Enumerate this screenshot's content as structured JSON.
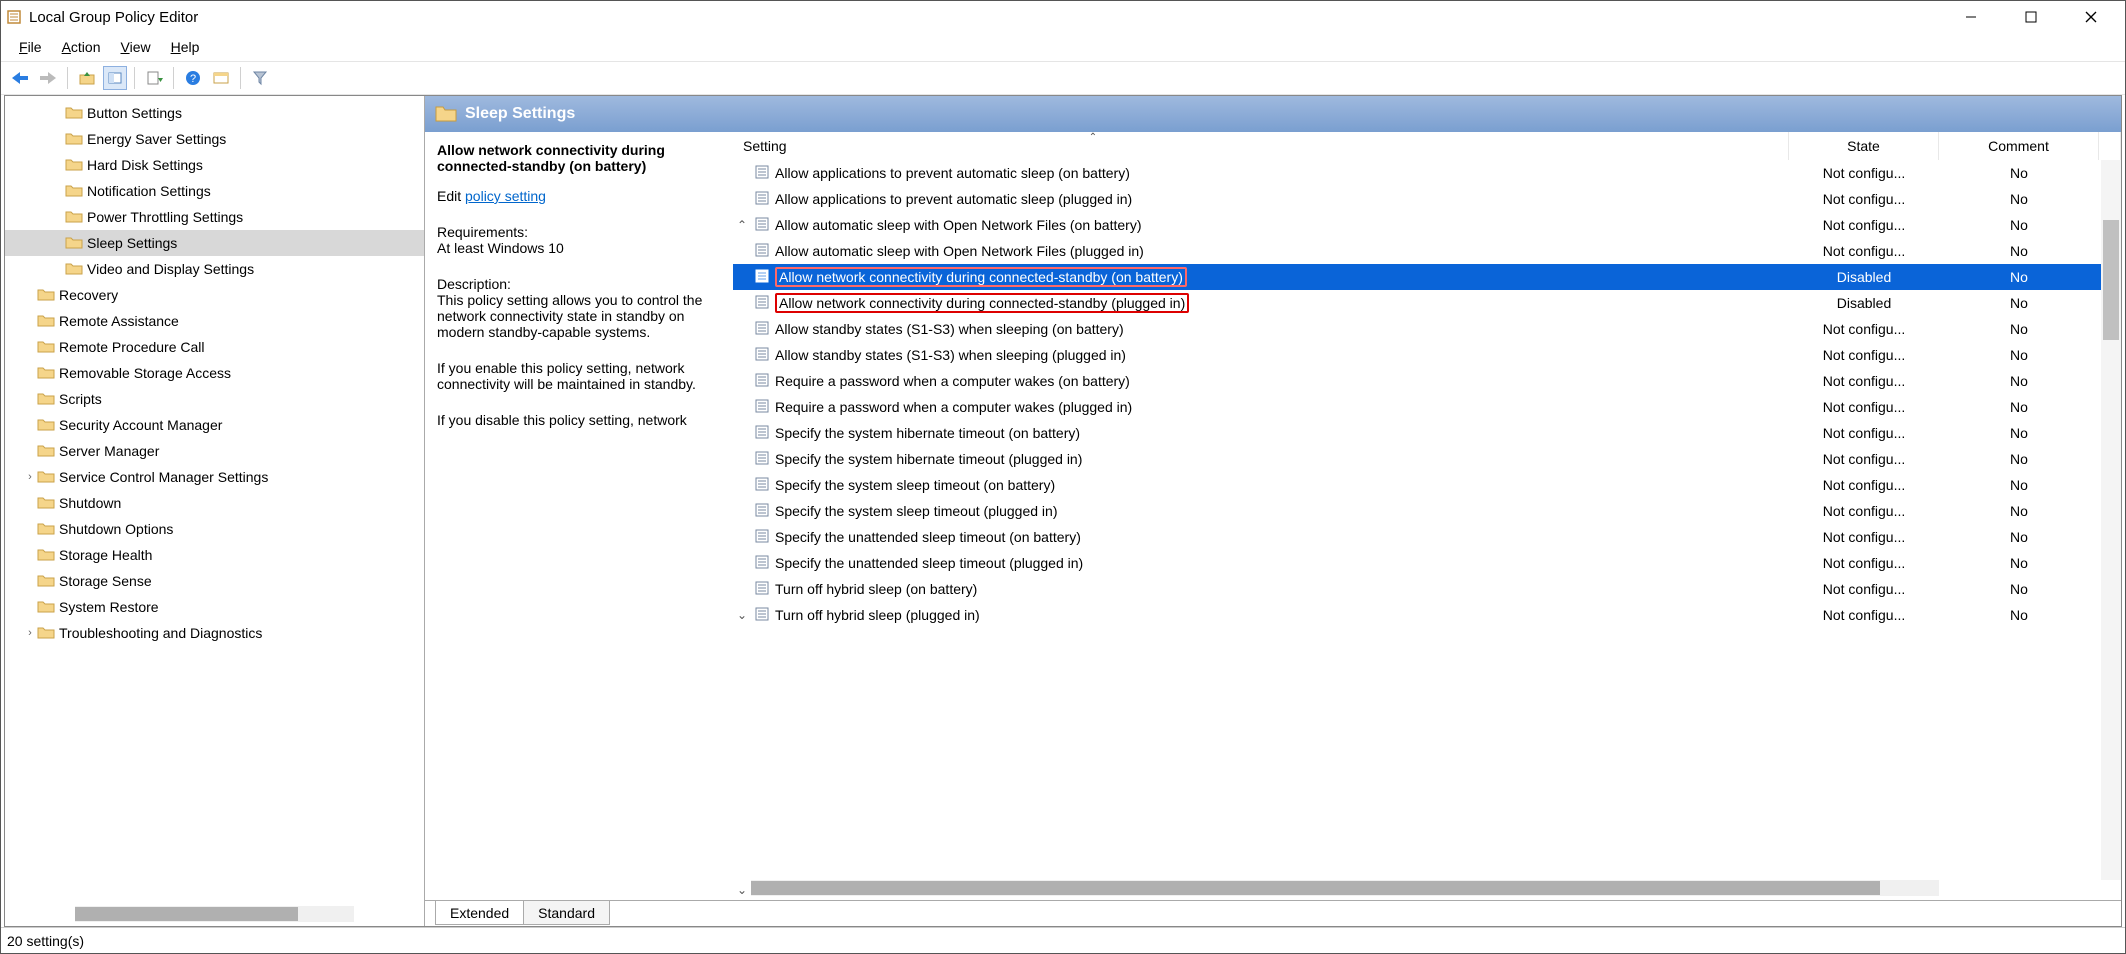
{
  "window": {
    "title": "Local Group Policy Editor"
  },
  "menu": {
    "file": "File",
    "action": "Action",
    "view": "View",
    "help": "Help"
  },
  "tree": {
    "items": [
      {
        "label": "Button Settings",
        "level": 2
      },
      {
        "label": "Energy Saver Settings",
        "level": 2
      },
      {
        "label": "Hard Disk Settings",
        "level": 2
      },
      {
        "label": "Notification Settings",
        "level": 2
      },
      {
        "label": "Power Throttling Settings",
        "level": 2
      },
      {
        "label": "Sleep Settings",
        "level": 2,
        "selected": true
      },
      {
        "label": "Video and Display Settings",
        "level": 2
      },
      {
        "label": "Recovery",
        "level": 1
      },
      {
        "label": "Remote Assistance",
        "level": 1
      },
      {
        "label": "Remote Procedure Call",
        "level": 1
      },
      {
        "label": "Removable Storage Access",
        "level": 1
      },
      {
        "label": "Scripts",
        "level": 1
      },
      {
        "label": "Security Account Manager",
        "level": 1
      },
      {
        "label": "Server Manager",
        "level": 1
      },
      {
        "label": "Service Control Manager Settings",
        "level": 1,
        "exp": true
      },
      {
        "label": "Shutdown",
        "level": 1
      },
      {
        "label": "Shutdown Options",
        "level": 1
      },
      {
        "label": "Storage Health",
        "level": 1
      },
      {
        "label": "Storage Sense",
        "level": 1
      },
      {
        "label": "System Restore",
        "level": 1
      },
      {
        "label": "Troubleshooting and Diagnostics",
        "level": 1,
        "exp": true
      }
    ]
  },
  "right": {
    "header": "Sleep Settings",
    "selected_name": "Allow network connectivity during connected-standby (on battery)",
    "edit_label": "Edit",
    "edit_link": "policy setting",
    "req_label": "Requirements:",
    "req_text": "At least Windows 10",
    "desc_label": "Description:",
    "desc_text1": "This policy setting allows you to control the network connectivity state in standby on modern standby-capable systems.",
    "desc_text2": "If you enable this policy setting, network connectivity will be maintained in standby.",
    "desc_text3": "If you disable this policy setting, network"
  },
  "listHeader": {
    "setting": "Setting",
    "state": "State",
    "comment": "Comment"
  },
  "rows": [
    {
      "name": "Allow applications to prevent automatic sleep (on battery)",
      "state": "Not configu...",
      "comment": "No"
    },
    {
      "name": "Allow applications to prevent automatic sleep (plugged in)",
      "state": "Not configu...",
      "comment": "No"
    },
    {
      "name": "Allow automatic sleep with Open Network Files (on battery)",
      "state": "Not configu...",
      "comment": "No",
      "arrow": "up"
    },
    {
      "name": "Allow automatic sleep with Open Network Files (plugged in)",
      "state": "Not configu...",
      "comment": "No"
    },
    {
      "name": "Allow network connectivity during connected-standby (on battery)",
      "state": "Disabled",
      "comment": "No",
      "selected": true,
      "red": true
    },
    {
      "name": "Allow network connectivity during connected-standby (plugged in)",
      "state": "Disabled",
      "comment": "No",
      "red": true
    },
    {
      "name": "Allow standby states (S1-S3) when sleeping (on battery)",
      "state": "Not configu...",
      "comment": "No"
    },
    {
      "name": "Allow standby states (S1-S3) when sleeping (plugged in)",
      "state": "Not configu...",
      "comment": "No"
    },
    {
      "name": "Require a password when a computer wakes (on battery)",
      "state": "Not configu...",
      "comment": "No"
    },
    {
      "name": "Require a password when a computer wakes (plugged in)",
      "state": "Not configu...",
      "comment": "No"
    },
    {
      "name": "Specify the system hibernate timeout (on battery)",
      "state": "Not configu...",
      "comment": "No"
    },
    {
      "name": "Specify the system hibernate timeout (plugged in)",
      "state": "Not configu...",
      "comment": "No"
    },
    {
      "name": "Specify the system sleep timeout (on battery)",
      "state": "Not configu...",
      "comment": "No"
    },
    {
      "name": "Specify the system sleep timeout (plugged in)",
      "state": "Not configu...",
      "comment": "No"
    },
    {
      "name": "Specify the unattended sleep timeout (on battery)",
      "state": "Not configu...",
      "comment": "No"
    },
    {
      "name": "Specify the unattended sleep timeout (plugged in)",
      "state": "Not configu...",
      "comment": "No"
    },
    {
      "name": "Turn off hybrid sleep (on battery)",
      "state": "Not configu...",
      "comment": "No"
    },
    {
      "name": "Turn off hybrid sleep (plugged in)",
      "state": "Not configu...",
      "comment": "No",
      "arrow": "down"
    }
  ],
  "tabs": {
    "extended": "Extended",
    "standard": "Standard"
  },
  "status": "20 setting(s)"
}
